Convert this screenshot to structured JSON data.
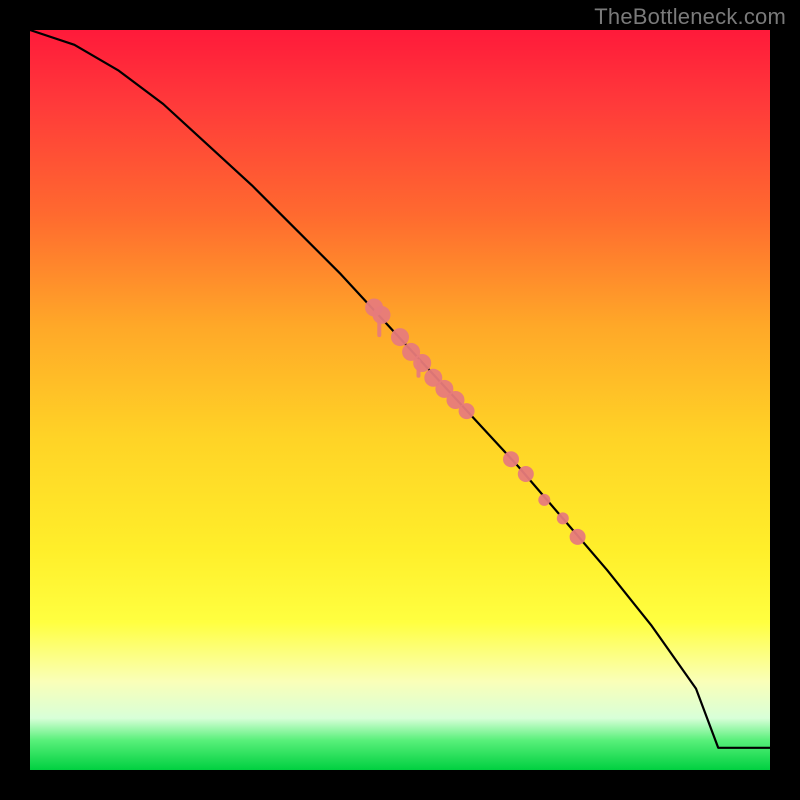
{
  "watermark": "TheBottleneck.com",
  "colors": {
    "marker": "#e77b7b",
    "curve": "#000000",
    "frame": "#000000"
  },
  "chart_data": {
    "type": "line",
    "title": "",
    "xlabel": "",
    "ylabel": "",
    "xlim": [
      0,
      100
    ],
    "ylim": [
      0,
      100
    ],
    "grid": false,
    "legend": false,
    "series": [
      {
        "name": "curve",
        "x": [
          0,
          6,
          12,
          18,
          24,
          30,
          36,
          42,
          48,
          54,
          60,
          66,
          72,
          78,
          84,
          90,
          93,
          100
        ],
        "y": [
          100,
          98,
          94.5,
          90,
          84.5,
          79,
          73,
          67,
          60.5,
          54,
          47.5,
          41,
          34,
          27,
          19.5,
          11,
          3,
          3
        ]
      }
    ],
    "markers": [
      {
        "x": 46.5,
        "y": 62.5,
        "r": 9
      },
      {
        "x": 47.5,
        "y": 61.5,
        "r": 9
      },
      {
        "x": 50.0,
        "y": 58.5,
        "r": 9
      },
      {
        "x": 51.5,
        "y": 56.5,
        "r": 9
      },
      {
        "x": 53.0,
        "y": 55.0,
        "r": 9
      },
      {
        "x": 54.5,
        "y": 53.0,
        "r": 9
      },
      {
        "x": 56.0,
        "y": 51.5,
        "r": 9
      },
      {
        "x": 57.5,
        "y": 50.0,
        "r": 9
      },
      {
        "x": 59.0,
        "y": 48.5,
        "r": 8
      },
      {
        "x": 65.0,
        "y": 42.0,
        "r": 8
      },
      {
        "x": 67.0,
        "y": 40.0,
        "r": 8
      },
      {
        "x": 69.5,
        "y": 36.5,
        "r": 6
      },
      {
        "x": 72.0,
        "y": 34.0,
        "r": 6
      },
      {
        "x": 74.0,
        "y": 31.5,
        "r": 8
      }
    ],
    "drips": [
      {
        "x": 47.2,
        "y_top": 61.0,
        "len": 2.5
      },
      {
        "x": 52.5,
        "y_top": 55.5,
        "len": 2.5
      }
    ]
  }
}
